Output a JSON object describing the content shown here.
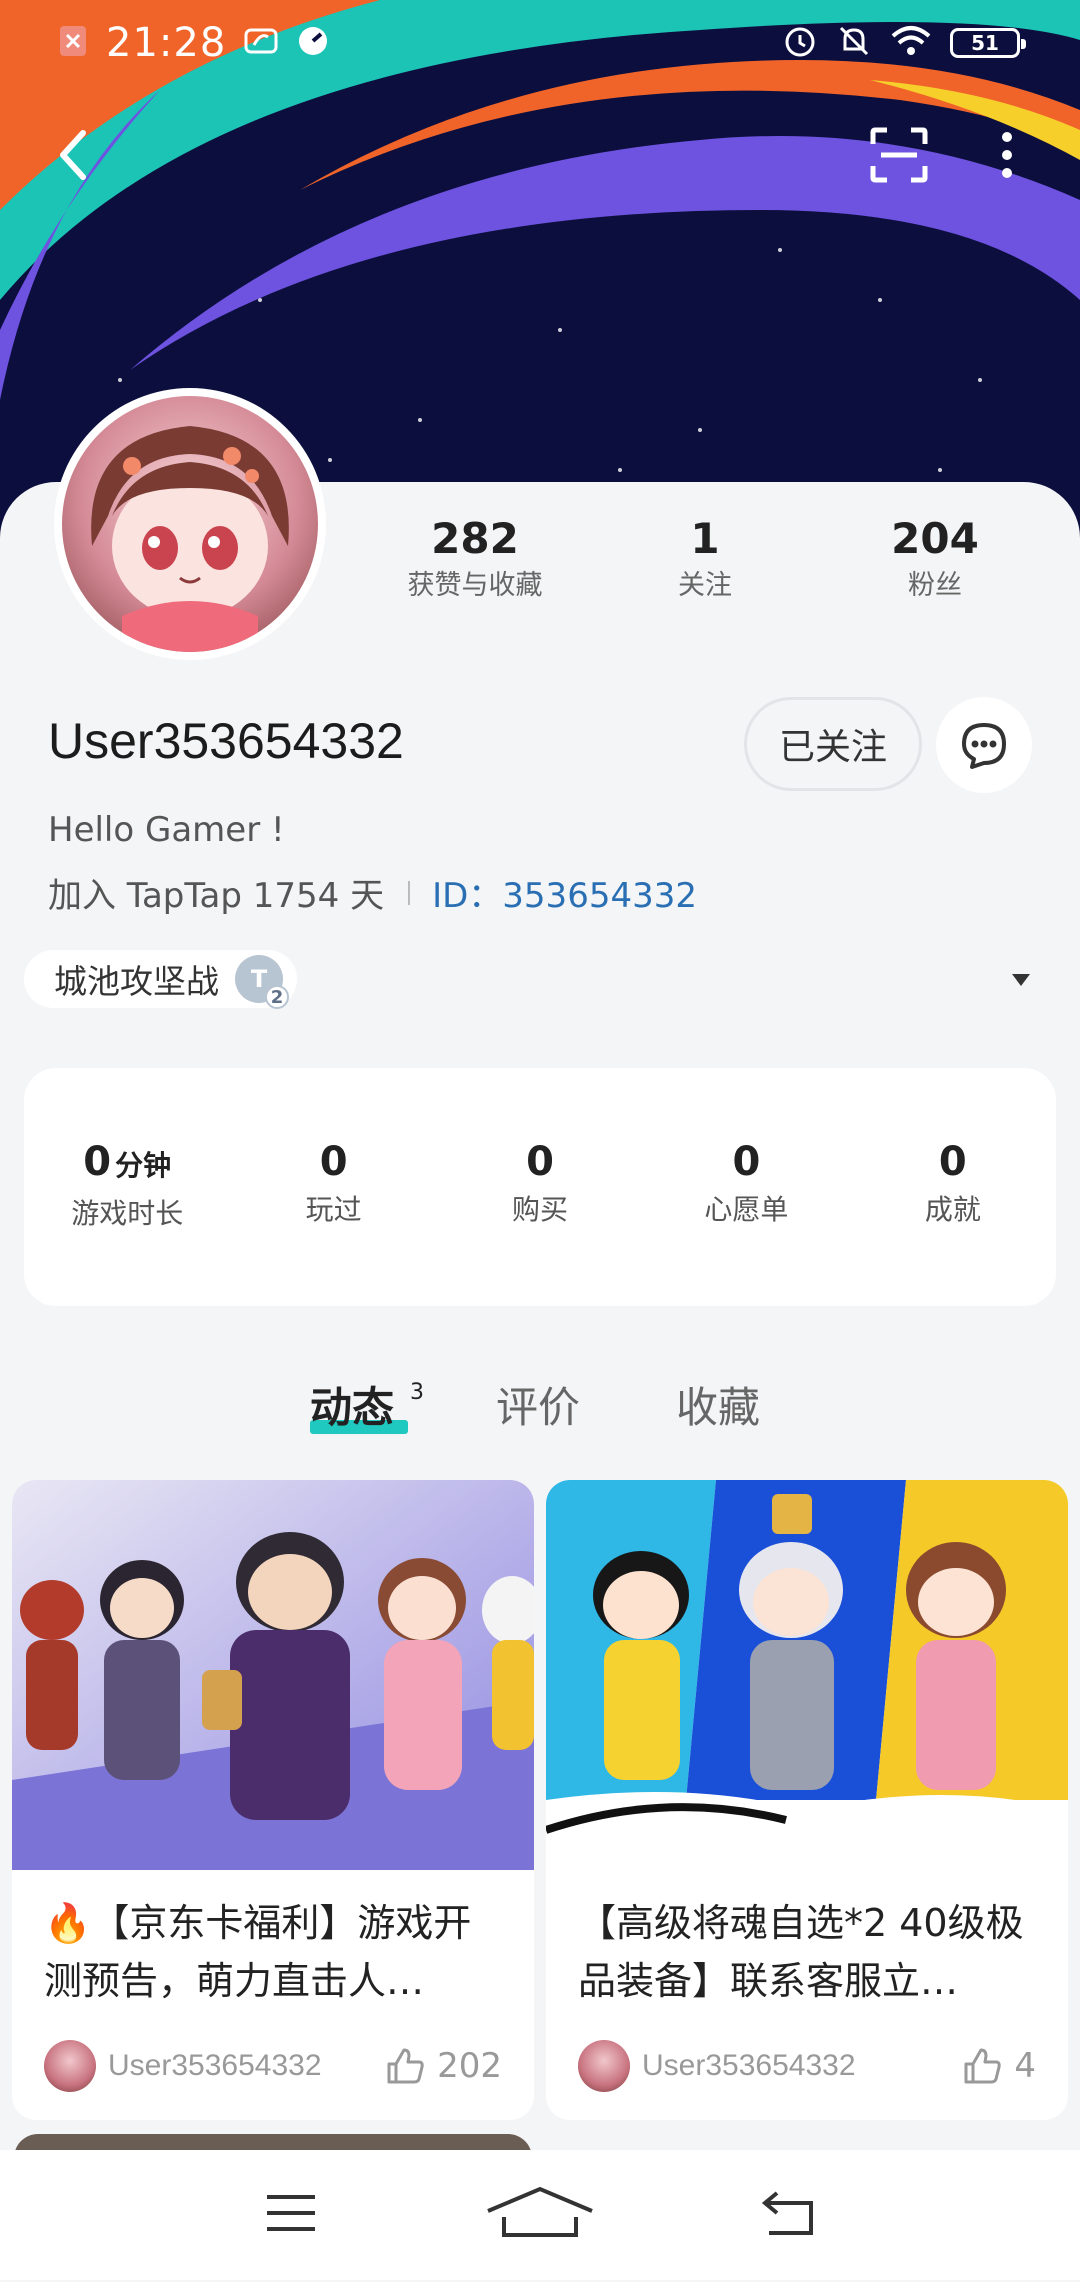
{
  "status_bar": {
    "time": "21:28",
    "battery": "51"
  },
  "profile": {
    "username": "User353654332",
    "bio": "Hello Gamer !",
    "joined": "加入 TapTap 1754 天",
    "id_label": "ID：",
    "id_value": "353654332",
    "follow_button": "已关注",
    "stats": [
      {
        "value": "282",
        "label": "获赞与收藏"
      },
      {
        "value": "1",
        "label": "关注"
      },
      {
        "value": "204",
        "label": "粉丝"
      }
    ],
    "game_tag": "城池攻坚战",
    "tag_badge": "T",
    "tag_badge_sub": "2"
  },
  "game_stats": [
    {
      "value": "0",
      "unit": "分钟",
      "label": "游戏时长"
    },
    {
      "value": "0",
      "unit": "",
      "label": "玩过"
    },
    {
      "value": "0",
      "unit": "",
      "label": "购买"
    },
    {
      "value": "0",
      "unit": "",
      "label": "心愿单"
    },
    {
      "value": "0",
      "unit": "",
      "label": "成就"
    }
  ],
  "tabs": {
    "items": [
      "动态",
      "评价",
      "收藏"
    ],
    "active": "动态",
    "count": "3"
  },
  "posts": [
    {
      "title": "🔥【京东卡福利】游戏开测预告，萌力直击人…",
      "user": "User353654332",
      "likes": "202"
    },
    {
      "title": "【高级将魂自选*2 40级极品装备】联系客服立…",
      "user": "User353654332",
      "likes": "4"
    }
  ],
  "colors": {
    "accent": "#1fc9c0",
    "id_link": "#2a6fb3",
    "banner_bg": "#0c0f3e",
    "banner_teal": "#1cc4b6",
    "banner_orange": "#f0642a",
    "banner_purple": "#6d53e0"
  }
}
